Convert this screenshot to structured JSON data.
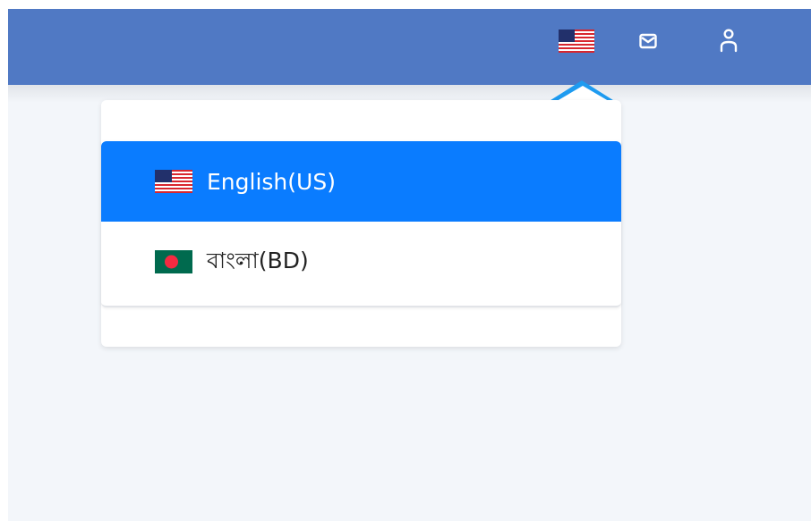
{
  "topbar": {
    "background_color": "#5079c4",
    "icons": [
      {
        "name": "us-flag-icon",
        "role": "language-switcher"
      },
      {
        "name": "mail-icon",
        "role": "messages"
      },
      {
        "name": "user-icon",
        "role": "account"
      }
    ]
  },
  "language_dropdown": {
    "items": [
      {
        "label": "English(US)",
        "flag": "us-flag-icon",
        "selected": true
      },
      {
        "label": "বাংলা(BD)",
        "flag": "bd-flag-icon",
        "selected": false
      }
    ],
    "active_color": "#0a7cff"
  }
}
